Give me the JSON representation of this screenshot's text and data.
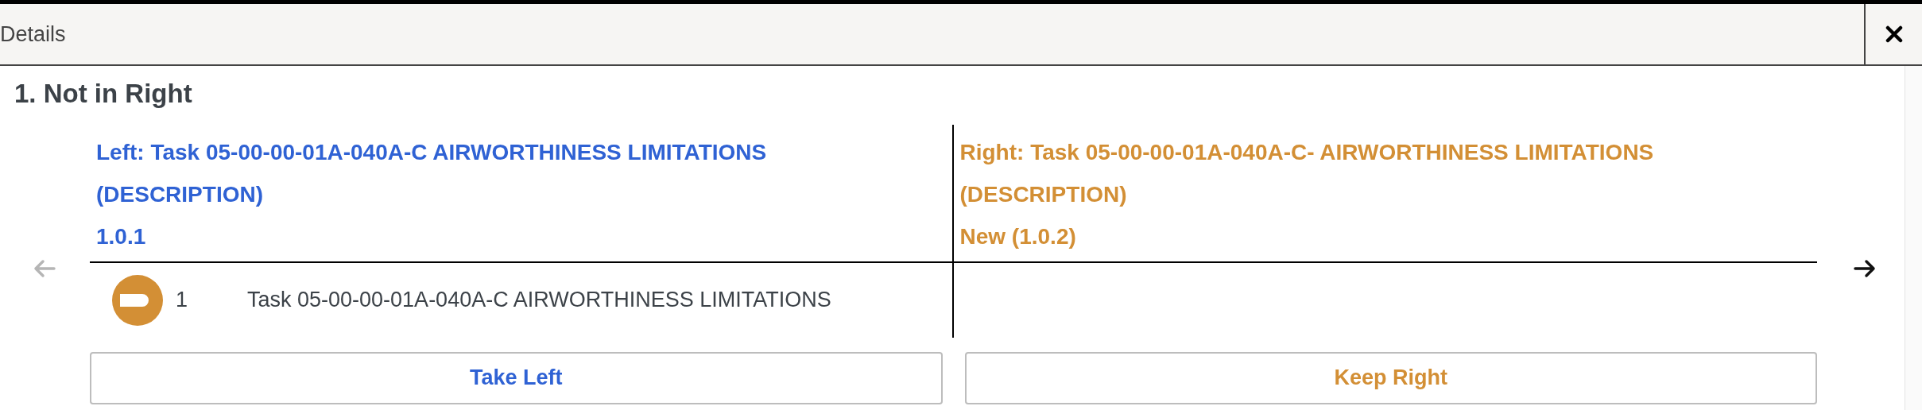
{
  "window": {
    "title": "Details"
  },
  "section": {
    "heading": "1. Not in Right"
  },
  "navigation": {
    "previous_disabled": true,
    "next_disabled": false
  },
  "left": {
    "title": "Left: Task 05-00-00-01A-040A-C AIRWORTHINESS LIMITATIONS (DESCRIPTION)",
    "version": "1.0.1"
  },
  "right": {
    "title": "Right: Task 05-00-00-01A-040A-C- AIRWORTHINESS LIMITATIONS (DESCRIPTION)",
    "version": "New (1.0.2)"
  },
  "rows": [
    {
      "number": "1",
      "text": "Task 05-00-00-01A-040A-C AIRWORTHINESS LIMITATIONS"
    }
  ],
  "buttons": {
    "left": "Take Left",
    "right": "Keep Right"
  }
}
